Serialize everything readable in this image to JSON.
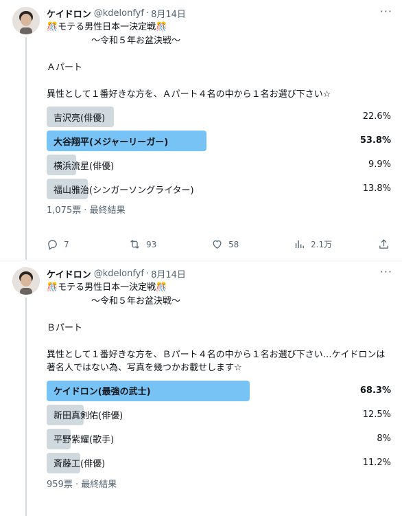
{
  "tweets": [
    {
      "author_name": "ケイドロン",
      "handle": "@kdelonfyf",
      "separator": "·",
      "date": "8月14日",
      "more_icon": "more-dots-icon",
      "body": "🎊モテる男性日本一決定戦🎊\n　　　　　～令和５年お盆決戦～\n\nＡパート\n\n異性として１番好きな方を、Ａパート４名の中から１名お選び下さい☆",
      "poll": [
        {
          "label": "吉沢亮(俳優)",
          "percent_text": "22.6%",
          "percent": 22.6,
          "winner": false
        },
        {
          "label": "大谷翔平(メジャーリーガー)",
          "percent_text": "53.8%",
          "percent": 53.8,
          "winner": true
        },
        {
          "label": "横浜流星(俳優)",
          "percent_text": "9.9%",
          "percent": 9.9,
          "winner": false
        },
        {
          "label": "福山雅治(シンガーソングライター)",
          "percent_text": "13.8%",
          "percent": 13.8,
          "winner": false
        }
      ],
      "poll_meta": "1,075票 · 最終結果",
      "actions": {
        "replies": "7",
        "retweets": "93",
        "likes": "58",
        "views": "2.1万"
      }
    },
    {
      "author_name": "ケイドロン",
      "handle": "@kdelonfyf",
      "separator": "·",
      "date": "8月14日",
      "more_icon": "more-dots-icon",
      "body": "🎊モテる男性日本一決定戦🎊\n　　　　　～令和５年お盆決戦～\n\nＢパート\n\n異性として１番好きな方を、Ｂパート４名の中から１名お選び下さい…ケイドロンは著名人ではない為、写真を幾つかお載せします☆",
      "poll": [
        {
          "label": "ケイドロン(最強の武士)",
          "percent_text": "68.3%",
          "percent": 68.3,
          "winner": true
        },
        {
          "label": "新田真剣佑(俳優)",
          "percent_text": "12.5%",
          "percent": 12.5,
          "winner": false
        },
        {
          "label": "平野紫耀(歌手)",
          "percent_text": "8%",
          "percent": 8,
          "winner": false
        },
        {
          "label": "斎藤工(俳優)",
          "percent_text": "11.2%",
          "percent": 11.2,
          "winner": false
        }
      ],
      "poll_meta": "959票 · 最終結果"
    }
  ],
  "colors": {
    "winner_bar": "#1d9bf0",
    "loser_bar": "#cfd9de",
    "muted_text": "#536471",
    "thread_line": "#cfd9de"
  }
}
